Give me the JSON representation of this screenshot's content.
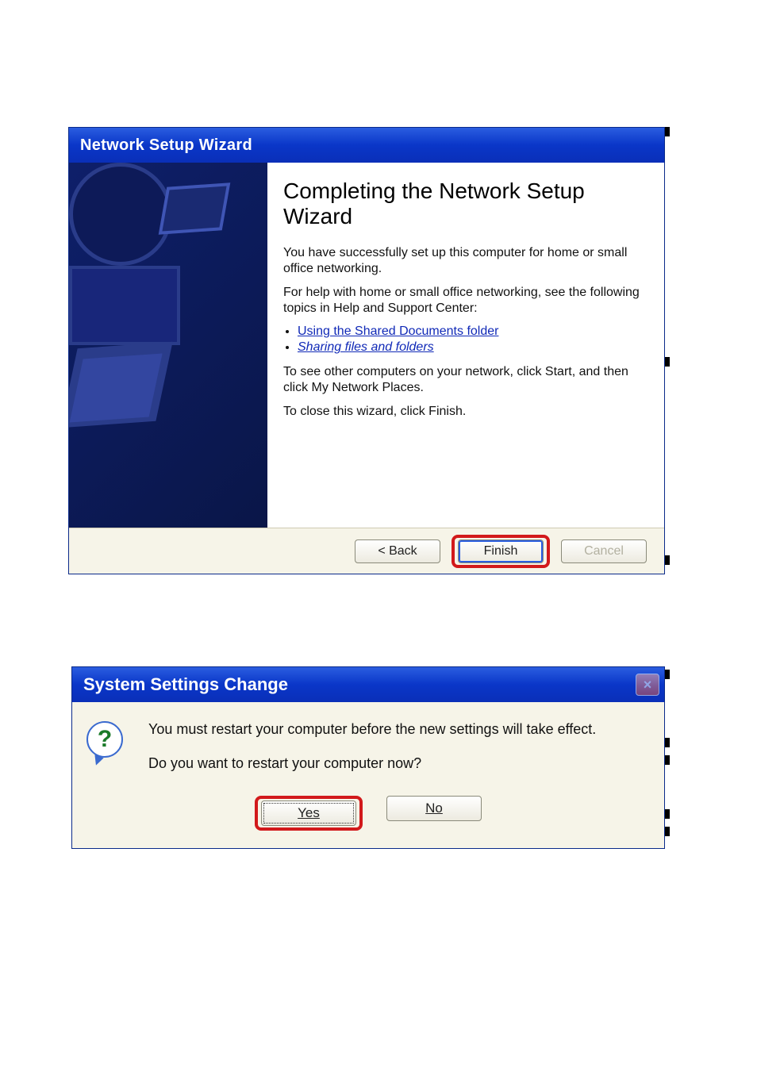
{
  "wizard": {
    "title": "Network Setup Wizard",
    "heading": "Completing the Network Setup Wizard",
    "para1": "You have successfully set up this computer for home or small office networking.",
    "para2": "For help with home or small office networking, see the following topics in Help and Support Center:",
    "links": {
      "shared_docs": "Using the Shared Documents folder",
      "sharing_files": "Sharing files and folders"
    },
    "para3": "To see other computers on your network, click Start, and then click My Network Places.",
    "close_hint": "To close this wizard, click Finish.",
    "buttons": {
      "back": "< Back",
      "finish": "Finish",
      "cancel": "Cancel"
    }
  },
  "confirm": {
    "title": "System Settings Change",
    "msg1": "You must restart your computer before the new settings will take effect.",
    "msg2": "Do you want to restart your computer now?",
    "buttons": {
      "yes": "Yes",
      "no": "No"
    }
  }
}
